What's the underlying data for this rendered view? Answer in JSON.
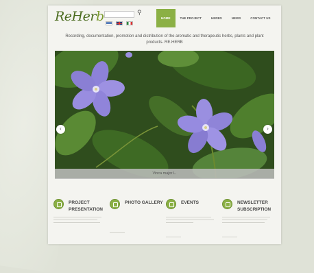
{
  "header": {
    "logo_main": "ReHer",
    "logo_accent": "b",
    "search": {
      "placeholder": ""
    },
    "languages": [
      "gr",
      "uk",
      "it"
    ]
  },
  "nav": {
    "items": [
      {
        "label": "HOME",
        "active": true
      },
      {
        "label": "THE PROJECT",
        "active": false
      },
      {
        "label": "HERBS",
        "active": false
      },
      {
        "label": "NEWS",
        "active": false
      },
      {
        "label": "CONTACT US",
        "active": false
      }
    ]
  },
  "tagline": "Recording, documentation, promotion and distribution of the aromatic and therapeutic herbs, plants and plant products- RE.HERB",
  "slider": {
    "caption": "Vinca major L.",
    "prev_label": "‹",
    "next_label": "›"
  },
  "features": [
    {
      "title": "PROJECT PRESENTATION"
    },
    {
      "title": "PHOTO GALLERY"
    },
    {
      "title": "EVENTS"
    },
    {
      "title": "NEWSLETTER SUBSCRIPTION"
    }
  ],
  "colors": {
    "accent": "#8bb045",
    "flower": "#9b8fe0",
    "leaf": "#3d6b22"
  }
}
